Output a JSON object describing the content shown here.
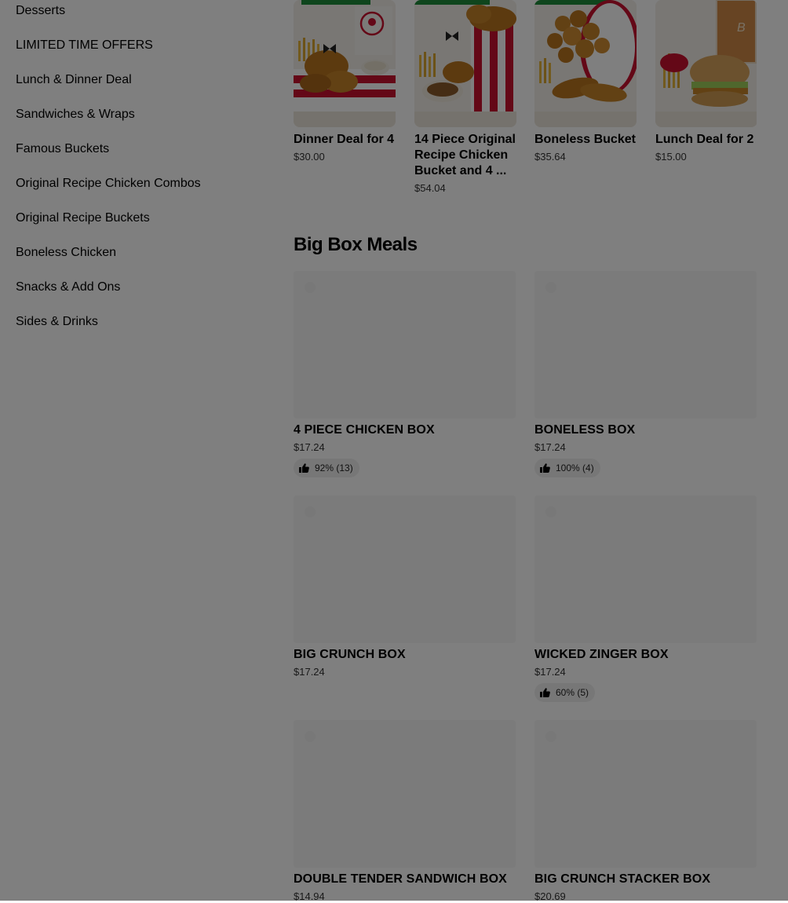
{
  "sidebar": {
    "items": [
      {
        "label": "Desserts"
      },
      {
        "label": "LIMITED TIME OFFERS"
      },
      {
        "label": "Lunch & Dinner Deal"
      },
      {
        "label": "Sandwiches & Wraps"
      },
      {
        "label": "Famous Buckets"
      },
      {
        "label": "Original Recipe Chicken Combos"
      },
      {
        "label": "Original Recipe Buckets"
      },
      {
        "label": "Boneless Chicken"
      },
      {
        "label": "Snacks & Add Ons"
      },
      {
        "label": "Sides & Drinks"
      }
    ]
  },
  "featured": {
    "items": [
      {
        "title": "Dinner Deal for 4",
        "price": "$30.00"
      },
      {
        "title": "14 Piece Original Recipe Chicken Bucket and 4 ...",
        "price": "$54.04"
      },
      {
        "title": "Boneless Bucket",
        "price": "$35.64"
      },
      {
        "title": "Lunch Deal for 2",
        "price": "$15.00"
      }
    ]
  },
  "section": {
    "title": "Big Box Meals",
    "items": [
      {
        "name": "4 PIECE CHICKEN BOX",
        "price": "$17.24",
        "rating": "92% (13)"
      },
      {
        "name": "BONELESS BOX",
        "price": "$17.24",
        "rating": "100% (4)"
      },
      {
        "name": "BIG CRUNCH BOX",
        "price": "$17.24"
      },
      {
        "name": "WICKED ZINGER BOX",
        "price": "$17.24",
        "rating": "60% (5)"
      },
      {
        "name": "DOUBLE TENDER SANDWICH BOX",
        "price": "$14.94"
      },
      {
        "name": "BIG CRUNCH STACKER BOX",
        "price": "$20.69"
      }
    ]
  },
  "colors": {
    "overlay": "rgba(0,0,0,0.5)",
    "badge_green": "#1f8a3b",
    "kfc_red": "#c8102e"
  },
  "icons": {
    "rating": "thumbs-up-icon"
  }
}
